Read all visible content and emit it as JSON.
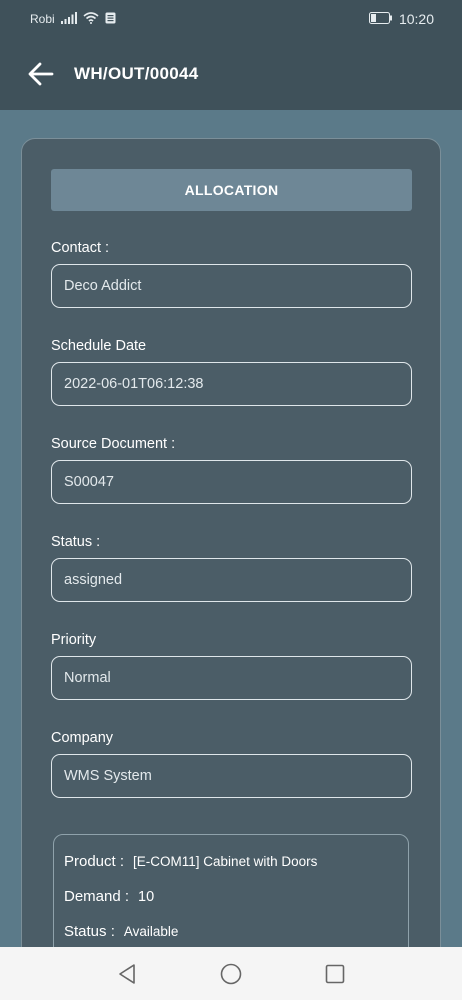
{
  "status_bar": {
    "carrier": "Robi",
    "time": "10:20",
    "icons": [
      "signal-icon",
      "wifi-icon",
      "sim-icon",
      "battery-icon"
    ]
  },
  "app_bar": {
    "title": "WH/OUT/00044",
    "back_icon": "arrow-left-icon"
  },
  "allocation_button": "ALLOCATION",
  "fields": {
    "contact": {
      "label": "Contact :",
      "value": "Deco Addict"
    },
    "schedule_date": {
      "label": "Schedule Date",
      "value": "2022-06-01T06:12:38"
    },
    "source_document": {
      "label": "Source Document :",
      "value": "S00047"
    },
    "status": {
      "label": "Status :",
      "value": "assigned"
    },
    "priority": {
      "label": "Priority",
      "value": "Normal"
    },
    "company": {
      "label": "Company",
      "value": "WMS System"
    }
  },
  "product_line": {
    "product_label": "Product :",
    "product_value": "[E-COM11] Cabinet with Doors",
    "demand_label": "Demand :",
    "demand_value": "10",
    "status_label": "Status :",
    "status_value": "Available"
  },
  "nav_bar": {
    "icons": [
      "back-triangle-icon",
      "home-circle-icon",
      "recents-square-icon"
    ]
  },
  "colors": {
    "background": "#5b7a89",
    "header": "#3f515a",
    "card": "#4b5d67",
    "button": "#6e8796"
  }
}
